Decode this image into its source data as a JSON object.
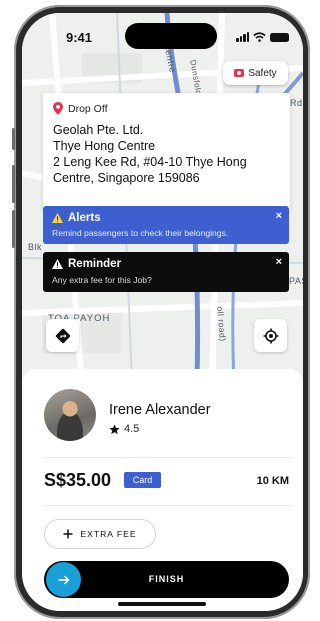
{
  "status": {
    "time": "9:41"
  },
  "map": {
    "street_labels": [
      "Centre",
      "Dunsfold",
      "Rd",
      "Blk",
      "PAS",
      "TOA PAYOH",
      "oll road)"
    ]
  },
  "safety": {
    "label": "Safety"
  },
  "dropoff": {
    "title": "Drop Off",
    "lines": [
      "Geolah Pte. Ltd.",
      "Thye Hong Centre",
      "2 Leng Kee Rd, #04-10 Thye Hong",
      "Centre, Singapore 159086"
    ]
  },
  "alert": {
    "title": "Alerts",
    "text": "Remind passengers to check their belongings.",
    "close": "×"
  },
  "reminder": {
    "title": "Reminder",
    "text": "Any extra fee for this Job?",
    "close": "×"
  },
  "driver": {
    "name": "Irene Alexander",
    "rating": "4.5"
  },
  "fare": {
    "price": "S$35.00",
    "payment": "Card",
    "distance": "10 KM"
  },
  "actions": {
    "extra_fee": "EXTRA FEE",
    "finish": "FINISH"
  },
  "icons": {
    "signal": "signal-icon",
    "wifi": "wifi-icon",
    "battery": "battery-icon",
    "pin": "location-pin-icon",
    "warning": "warning-icon",
    "navigate": "navigation-icon",
    "recenter": "crosshair-icon",
    "star": "star-icon",
    "plus": "plus-icon",
    "arrow": "arrow-right-icon"
  },
  "colors": {
    "alert_blue": "#3e5fcf",
    "finish_accent": "#1aa0d6",
    "pin_red": "#e2354d"
  }
}
